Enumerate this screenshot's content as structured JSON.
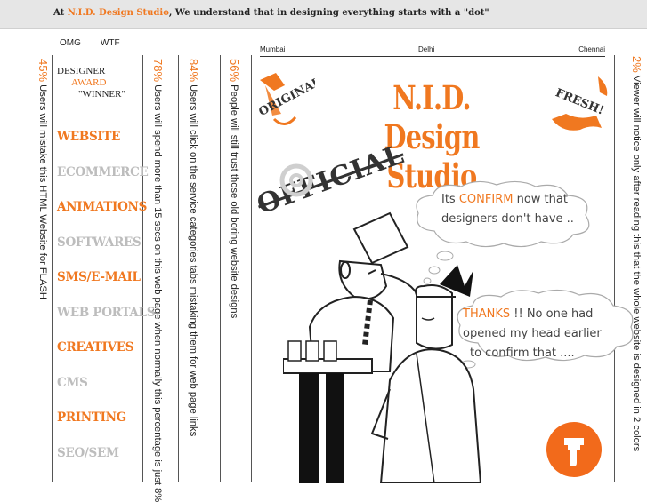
{
  "topbar": {
    "prefix": "At ",
    "brand": "N.I.D. Design Studio",
    "rest": ", We understand that in designing everything starts with a \"dot\""
  },
  "award": {
    "tabs": [
      "OMG",
      "WTF"
    ],
    "line1": "DESIGNER",
    "line2": "AWARD",
    "line3": "\"WINNER\""
  },
  "menu": [
    {
      "label": "WEBSITE",
      "style": "orange"
    },
    {
      "label": "ECOMMERCE",
      "style": "grey"
    },
    {
      "label": "ANIMATIONS",
      "style": "orange"
    },
    {
      "label": "SOFTWARES",
      "style": "grey"
    },
    {
      "label": "SMS/E-MAIL",
      "style": "orange"
    },
    {
      "label": "WEB PORTALS",
      "style": "grey"
    },
    {
      "label": "CREATIVES",
      "style": "orange"
    },
    {
      "label": "CMS",
      "style": "grey"
    },
    {
      "label": "PRINTING",
      "style": "orange"
    },
    {
      "label": "SEO/SEM",
      "style": "grey"
    }
  ],
  "stats": [
    {
      "pct": "45%",
      "text": " Users will mistake this HTML Website for FLASH"
    },
    {
      "pct": "78%",
      "text": " Users will spend more than 15 secs on this web page when normally this percentage is just 8%"
    },
    {
      "pct": "84%",
      "text": " Users will click on the service categories tabs mistaking them for web page links"
    },
    {
      "pct": "56%",
      "text": " People will still trust those old boring website designs"
    },
    {
      "pct": "2%",
      "text": " Viewer will notice only after reading this that the whole website is designed in 2 colors"
    }
  ],
  "cities": [
    "Mumbai",
    "Delhi",
    "Chennai"
  ],
  "title": {
    "line1": "N.I.D. Design",
    "line2": "Studio"
  },
  "badges": {
    "left": "ORIGINAL!",
    "right": "FRESH!"
  },
  "stamp": "OFFICIAL",
  "bubble1": {
    "pre": "Its ",
    "hl": "CONFIRM",
    "post": " now that",
    "line2": "designers don't have .."
  },
  "bubble2": {
    "hl": "THANKS",
    "post": " !!  No one had",
    "line2": "opened my head earlier",
    "line3": "to confirm that ...."
  },
  "colors": {
    "accent": "#f07820",
    "grey": "#bdbdbd"
  },
  "hand_button": {
    "icon": "pointing-hand-icon"
  }
}
